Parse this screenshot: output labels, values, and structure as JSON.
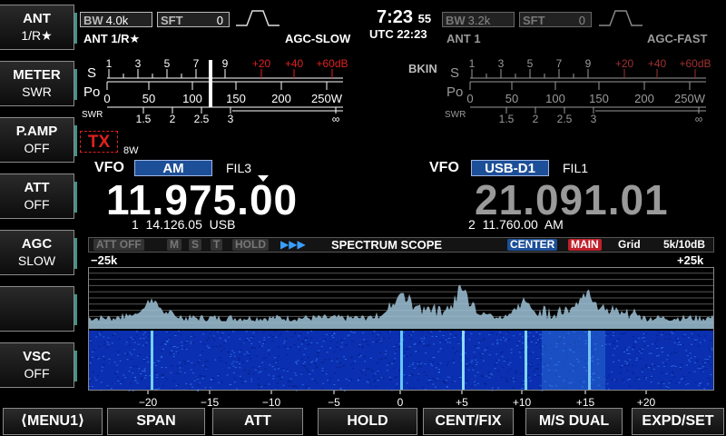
{
  "sidebar": [
    {
      "title": "ANT",
      "value": "1/R★",
      "top": 0
    },
    {
      "title": "METER",
      "value": "SWR",
      "top": 1
    },
    {
      "title": "P.AMP",
      "value": "OFF",
      "top": 2
    },
    {
      "title": "ATT",
      "value": "OFF",
      "top": 3
    },
    {
      "title": "AGC",
      "value": "SLOW",
      "top": 4
    },
    {
      "title": "",
      "value": "",
      "top": 5
    },
    {
      "title": "VSC",
      "value": "OFF",
      "top": 6
    }
  ],
  "main": {
    "bw_label": "BW",
    "bw_value": "4.0k",
    "sft_label": "SFT",
    "sft_value": "0",
    "ant": "ANT 1/R★",
    "agc": "AGC-SLOW",
    "vfo_label": "VFO",
    "mode": "AM",
    "filter": "FIL3",
    "frequency": "11.975.00",
    "memo_index": "1",
    "memo_freq": "14.126.05",
    "memo_mode": "USB",
    "tx": "TX",
    "power": "8W"
  },
  "clock": {
    "time": "7:23",
    "seconds": "55",
    "utc_label": "UTC",
    "utc_time": "22:23"
  },
  "sub": {
    "bw_label": "BW",
    "bw_value": "3.2k",
    "sft_label": "SFT",
    "sft_value": "0",
    "ant": "ANT 1",
    "agc": "AGC-FAST",
    "bkin": "BKIN",
    "vfo_label": "VFO",
    "mode": "USB-D1",
    "filter": "FIL1",
    "frequency": "21.091.01",
    "memo_index": "2",
    "memo_freq": "11.760.00",
    "memo_mode": "AM"
  },
  "meter": {
    "s_label": "S",
    "po_label": "Po",
    "swr_label": "SWR",
    "s_scale": [
      "1",
      "3",
      "5",
      "7",
      "9",
      "+20",
      "+40",
      "+60dB"
    ],
    "po_scale": [
      "0",
      "50",
      "100",
      "150",
      "200",
      "250W"
    ],
    "swr_scale": [
      "1.5",
      "2",
      "2.5",
      "3",
      "∞"
    ]
  },
  "scope": {
    "att": "ATT OFF",
    "m": "M",
    "s": "S",
    "t": "T",
    "hold": "HOLD",
    "arrows": "▶▶▶",
    "title": "SPECTRUM  SCOPE",
    "center": "CENTER",
    "main": "MAIN",
    "grid": "Grid",
    "span": "5k/10dB",
    "left_edge": "−25k",
    "right_edge": "+25k",
    "x_ticks": [
      "−20",
      "−15",
      "−10",
      "−5",
      "0",
      "+5",
      "+10",
      "+15",
      "+20"
    ]
  },
  "bottom": [
    "⟨MENU1⟩",
    "SPAN",
    "ATT",
    "HOLD",
    "CENT/FIX",
    "M/S  DUAL",
    "EXPD/SET"
  ],
  "colors": {
    "accent": "#1d4f98",
    "red": "#e02020",
    "scope_bg": "#0a2fb0"
  }
}
